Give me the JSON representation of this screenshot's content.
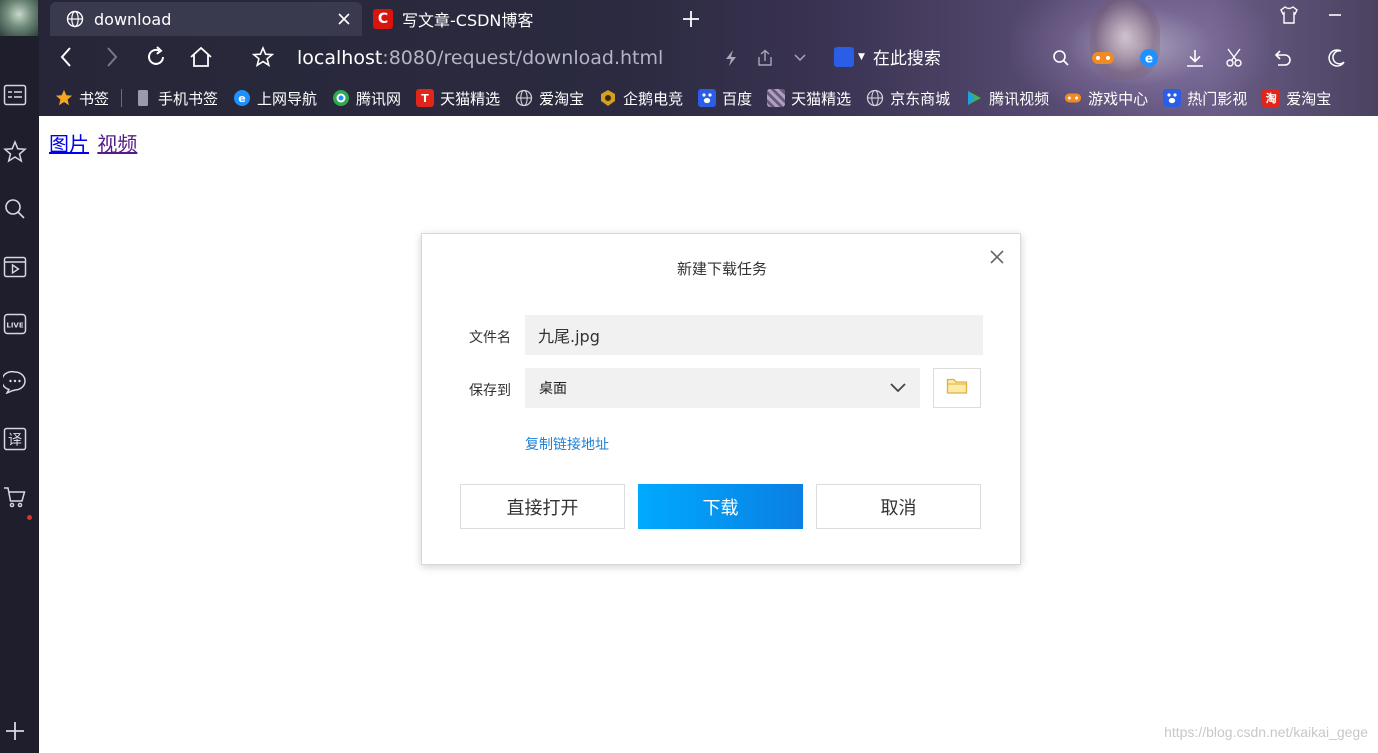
{
  "tabs": [
    {
      "title": "download",
      "active": true,
      "icon": "globe-icon"
    },
    {
      "title": "写文章-CSDN博客",
      "active": false,
      "icon": "csdn-icon"
    }
  ],
  "csdn_logo_letter": "C",
  "address": {
    "host": "localhost",
    "path": ":8080/request/download.html",
    "search_placeholder": "在此搜索"
  },
  "bookmarks": [
    {
      "label": "书签",
      "icon": "star-icon",
      "color": "#f5a623"
    },
    {
      "label": "手机书签",
      "icon": "phone-icon",
      "color": "#9a9aa8"
    },
    {
      "label": "上网导航",
      "icon": "ie-icon",
      "color": "#1e90ff"
    },
    {
      "label": "腾讯网",
      "icon": "tencent-icon",
      "color": "#2fa84f"
    },
    {
      "label": "天猫精选",
      "icon": "tmall-icon",
      "color": "#e1251b"
    },
    {
      "label": "爱淘宝",
      "icon": "globe-icon",
      "color": "#c8c8d0"
    },
    {
      "label": "企鹅电竞",
      "icon": "esports-icon",
      "color": "#d4a020"
    },
    {
      "label": "百度",
      "icon": "baidu-icon",
      "color": "#2b5ee6"
    },
    {
      "label": "天猫精选",
      "icon": "tmall-pattern-icon",
      "color": "#8a8a9a"
    },
    {
      "label": "京东商城",
      "icon": "globe-icon",
      "color": "#c8c8d0"
    },
    {
      "label": "腾讯视频",
      "icon": "video-play-icon",
      "color": "#3fb34f"
    },
    {
      "label": "游戏中心",
      "icon": "gamepad-icon",
      "color": "#f08a24"
    },
    {
      "label": "热门影视",
      "icon": "baidu-icon",
      "color": "#2b5ee6"
    },
    {
      "label": "爱淘宝",
      "icon": "taobao-icon",
      "color": "#e1251b"
    }
  ],
  "tmall_letter": "T",
  "taobao_letter": "淘",
  "page": {
    "links": [
      {
        "label": "图片"
      },
      {
        "label": "视频"
      }
    ]
  },
  "dialog": {
    "title": "新建下载任务",
    "filename_label": "文件名",
    "filename_value": "九尾.jpg",
    "saveto_label": "保存到",
    "saveto_value": "桌面",
    "copy_link_label": "复制链接地址",
    "open_label": "直接打开",
    "download_label": "下载",
    "cancel_label": "取消"
  },
  "watermark": "https://blog.csdn.net/kaikai_gege",
  "colors": {
    "accent": "#0a7fe2",
    "link": "#1e82d8",
    "chrome_bg": "#262637",
    "sidebar_bg": "#1e1e2c"
  }
}
